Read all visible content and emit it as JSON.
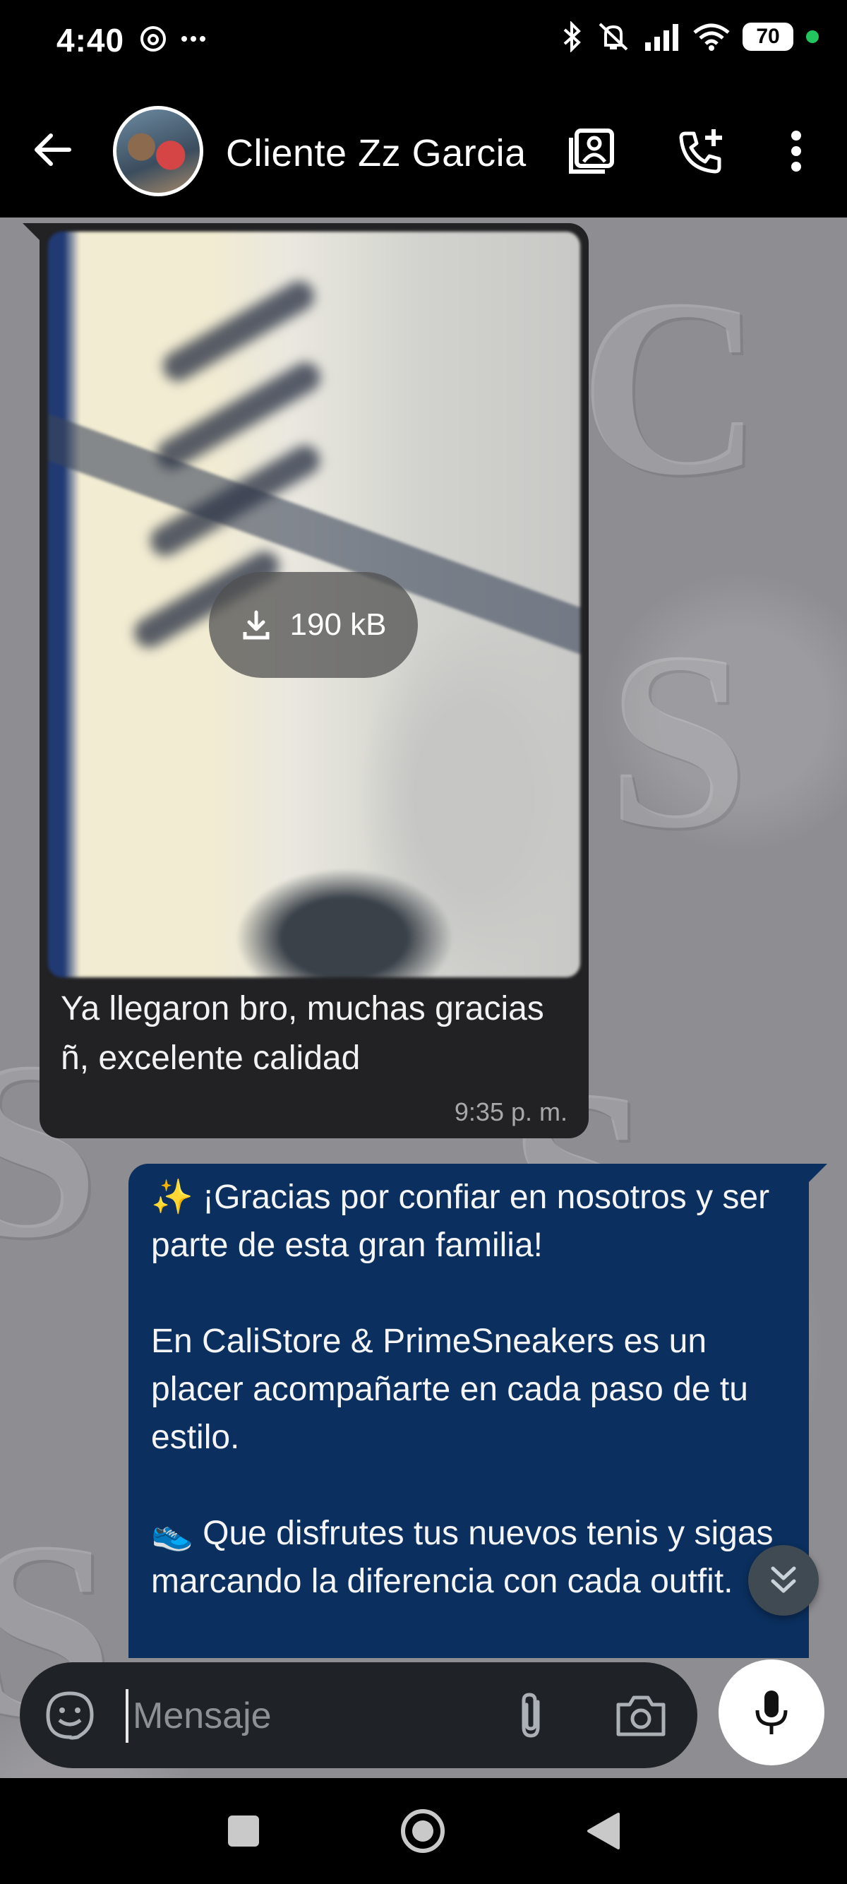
{
  "status_bar": {
    "time": "4:40",
    "battery": "70",
    "battery_level": 0.7,
    "left_icons": [
      "threads-icon",
      "more-notifications-icon"
    ],
    "right_icons": [
      "bluetooth-icon",
      "vibrate-off-icon",
      "signal-icon",
      "wifi-icon"
    ]
  },
  "header": {
    "contact_name": "Cliente Zz Garcia",
    "icons": [
      "back-arrow-icon",
      "contact-card-icon",
      "add-call-icon",
      "overflow-menu-icon"
    ]
  },
  "messages": {
    "incoming": {
      "download_size": "190 kB",
      "text": "Ya llegaron bro, muchas gracias ñ, excelente calidad",
      "time": "9:35 p. m."
    },
    "outgoing": {
      "text": "✨ ¡Gracias por confiar en nosotros y ser parte de esta gran familia!\n\nEn CaliStore & PrimeSneakers es un placer acompañarte en cada paso de tu estilo.\n\n👟 Que disfrutes tus nuevos tenis y sigas marcando la diferencia con cada outfit."
    }
  },
  "composer": {
    "placeholder": "Mensaje",
    "icons": [
      "sticker-icon",
      "attach-icon",
      "camera-icon",
      "microphone-icon"
    ]
  },
  "navigation": {
    "icons": [
      "recents-icon",
      "home-icon",
      "back-icon"
    ]
  },
  "colors": {
    "incoming_bubble": "#222224",
    "outgoing_bubble": "#0b2f5e",
    "chat_background": "#8e8d92",
    "online_dot": "#22c55e"
  }
}
